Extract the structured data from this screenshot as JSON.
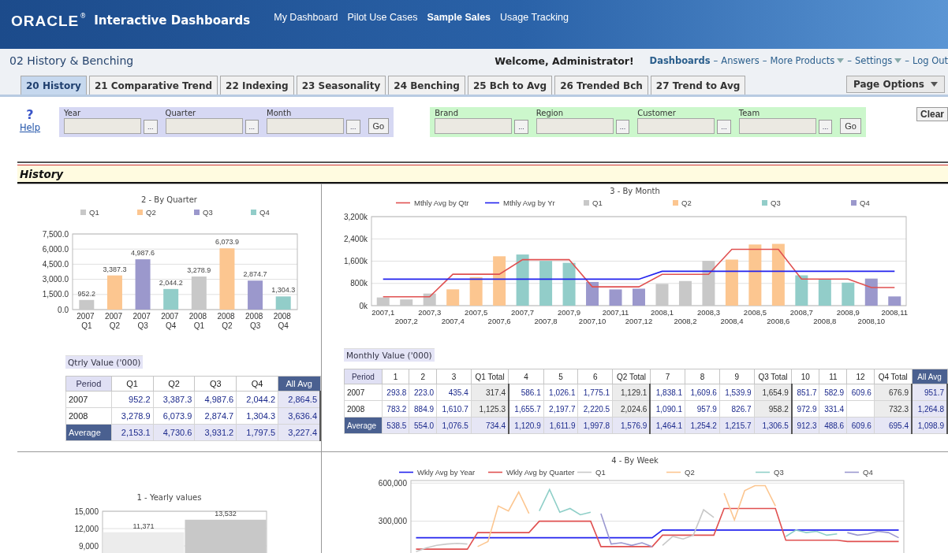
{
  "header": {
    "logo": "ORACLE",
    "logo_mark": "®",
    "app_title": "Interactive Dashboards",
    "nav": [
      {
        "label": "My Dashboard",
        "selected": false
      },
      {
        "label": "Pilot Use Cases",
        "selected": false
      },
      {
        "label": "Sample Sales",
        "selected": true
      },
      {
        "label": "Usage Tracking",
        "selected": false
      }
    ]
  },
  "title_bar": {
    "page_title": "02 History & Benching",
    "welcome": "Welcome, Administrator!",
    "links": [
      {
        "label": "Dashboards",
        "selected": true,
        "menu": false
      },
      {
        "separator": "–",
        "label": "Answers",
        "selected": false,
        "menu": false
      },
      {
        "separator": "–",
        "label": "More Products",
        "selected": false,
        "menu": true
      },
      {
        "separator": "–",
        "label": "Settings",
        "selected": false,
        "menu": true
      },
      {
        "separator": "–",
        "label": "Log Out",
        "selected": false,
        "menu": false
      }
    ]
  },
  "tabs": [
    {
      "label": "20 History",
      "selected": true
    },
    {
      "label": "21 Comparative Trend",
      "selected": false
    },
    {
      "label": "22 Indexing",
      "selected": false
    },
    {
      "label": "23 Seasonality",
      "selected": false
    },
    {
      "label": "24 Benching",
      "selected": false
    },
    {
      "label": "25 Bch to Avg",
      "selected": false
    },
    {
      "label": "26 Trended Bch",
      "selected": false
    },
    {
      "label": "27 Trend to Avg",
      "selected": false
    }
  ],
  "page_options": {
    "label": "Page Options",
    "menu": true
  },
  "help": {
    "mark": "?",
    "label": "Help"
  },
  "prompt_groups": [
    {
      "color": "#d6d8f3",
      "go": "Go",
      "fields": [
        {
          "label": "Year",
          "browse": "..."
        },
        {
          "label": "Quarter",
          "browse": "..."
        },
        {
          "label": "Month",
          "browse": "..."
        }
      ]
    },
    {
      "color": "#ccf7cc",
      "go": "Go",
      "fields": [
        {
          "label": "Brand",
          "browse": "..."
        },
        {
          "label": "Region",
          "browse": "..."
        },
        {
          "label": "Customer",
          "browse": "..."
        },
        {
          "label": "Team",
          "browse": "..."
        }
      ]
    }
  ],
  "clear": "Clear",
  "section_title": "History",
  "quarter_panel": {
    "title": "2 - By Quarter",
    "chart_data": {
      "type": "bar",
      "grid": true,
      "legend": true,
      "categories": [
        "2007 Q1",
        "2007 Q2",
        "2007 Q3",
        "2007 Q4",
        "2008 Q1",
        "2008 Q2",
        "2008 Q3",
        "2008 Q4"
      ],
      "series": [
        {
          "name": "Q1",
          "color": "#c8c8c8",
          "values": [
            952.2,
            null,
            null,
            null,
            3278.9,
            null,
            null,
            null
          ]
        },
        {
          "name": "Q2",
          "color": "#fcc690",
          "values": [
            null,
            3387.3,
            null,
            null,
            null,
            6073.9,
            null,
            null
          ]
        },
        {
          "name": "Q3",
          "color": "#9b98cc",
          "values": [
            null,
            null,
            4987.6,
            null,
            null,
            null,
            2874.7,
            null
          ]
        },
        {
          "name": "Q4",
          "color": "#92cdc9",
          "values": [
            null,
            null,
            null,
            2044.2,
            null,
            null,
            null,
            1304.3
          ]
        }
      ],
      "ylim": [
        0,
        7500
      ],
      "yticks": [
        {
          "value": 0,
          "label": "0.0"
        },
        {
          "value": 1500,
          "label": "1,500.0"
        },
        {
          "value": 3000,
          "label": "3,000.0"
        },
        {
          "value": 4500,
          "label": "4,500.0"
        },
        {
          "value": 6000,
          "label": "6,000.0"
        },
        {
          "value": 7500,
          "label": "7,500.0"
        }
      ],
      "value_labels": [
        "952.2",
        "3,387.3",
        "4,987.6",
        "2,044.2",
        "3,278.9",
        "6,073.9",
        "2,874.7",
        "1,304.3"
      ]
    },
    "table": {
      "title": "Qtrly Value ('000)",
      "columns": [
        {
          "label": "Period",
          "kind": "period"
        },
        {
          "label": "Q1",
          "kind": "value"
        },
        {
          "label": "Q2",
          "kind": "value"
        },
        {
          "label": "Q3",
          "kind": "value"
        },
        {
          "label": "Q4",
          "kind": "value"
        },
        {
          "label": "All Avg",
          "kind": "average"
        }
      ],
      "rows": [
        {
          "kind": "year",
          "cells": [
            "2007",
            "952.2",
            "3,387.3",
            "4,987.6",
            "2,044.2",
            "2,864.5"
          ]
        },
        {
          "kind": "year",
          "cells": [
            "2008",
            "3,278.9",
            "6,073.9",
            "2,874.7",
            "1,304.3",
            "3,636.4"
          ]
        },
        {
          "kind": "average",
          "cells": [
            "Average",
            "2,153.1",
            "4,730.6",
            "3,931.2",
            "1,797.5",
            "3,227.4"
          ]
        }
      ]
    }
  },
  "month_panel": {
    "title": "3 - By Month",
    "chart_data": {
      "type": "bar",
      "grid": true,
      "legend": true,
      "categories": [
        "2007,1",
        "2007,2",
        "2007,3",
        "2007,4",
        "2007,5",
        "2007,6",
        "2007,7",
        "2007,8",
        "2007,9",
        "2007,10",
        "2007,11",
        "2007,12",
        "2008,1",
        "2008,2",
        "2008,3",
        "2008,4",
        "2008,5",
        "2008,6",
        "2008,7",
        "2008,8",
        "2008,9",
        "2008,10",
        "2008,11"
      ],
      "series": [
        {
          "name": "Mthly Avg by Qtr",
          "type": "line",
          "color": "#e05050",
          "values": [
            317,
            317,
            317,
            1129,
            1129,
            1129,
            1655,
            1655,
            1655,
            677,
            677,
            677,
            1125,
            1125,
            1125,
            2025,
            2025,
            2025,
            958,
            958,
            958,
            651,
            651
          ]
        },
        {
          "name": "Mthly Avg by Yr",
          "type": "line",
          "color": "#2222ee",
          "values": [
            952,
            952,
            952,
            952,
            952,
            952,
            952,
            952,
            952,
            952,
            952,
            952,
            1235,
            1235,
            1235,
            1235,
            1235,
            1235,
            1235,
            1235,
            1235,
            1235,
            1235
          ]
        },
        {
          "name": "Q1",
          "color": "#c8c8c8",
          "values": [
            294,
            223,
            435,
            null,
            null,
            null,
            null,
            null,
            null,
            null,
            null,
            null,
            783,
            885,
            1611,
            null,
            null,
            null,
            null,
            null,
            null,
            null,
            null
          ]
        },
        {
          "name": "Q2",
          "color": "#fcc690",
          "values": [
            null,
            null,
            null,
            586,
            1026,
            1775,
            null,
            null,
            null,
            null,
            null,
            null,
            null,
            null,
            null,
            1656,
            2198,
            2221,
            null,
            null,
            null,
            null,
            null
          ]
        },
        {
          "name": "Q3",
          "color": "#92cdc9",
          "values": [
            null,
            null,
            null,
            null,
            null,
            null,
            1838,
            1610,
            1540,
            null,
            null,
            null,
            null,
            null,
            null,
            null,
            null,
            null,
            1090,
            958,
            827,
            null,
            null
          ]
        },
        {
          "name": "Q4",
          "color": "#9b98cc",
          "values": [
            null,
            null,
            null,
            null,
            null,
            null,
            null,
            null,
            null,
            852,
            583,
            610,
            null,
            null,
            null,
            null,
            null,
            null,
            null,
            null,
            null,
            973,
            331
          ]
        }
      ],
      "ylim": [
        0,
        3200
      ],
      "yticks": [
        {
          "value": 0,
          "label": "0k"
        },
        {
          "value": 800,
          "label": "800k"
        },
        {
          "value": 1600,
          "label": "1,600k"
        },
        {
          "value": 2400,
          "label": "2,400k"
        },
        {
          "value": 3200,
          "label": "3,200k"
        }
      ]
    },
    "table": {
      "title": "Monthly Value ('000)",
      "columns": [
        {
          "label": "Period",
          "kind": "period"
        },
        {
          "label": "1",
          "kind": "value"
        },
        {
          "label": "2",
          "kind": "value"
        },
        {
          "label": "3",
          "kind": "value"
        },
        {
          "label": "Q1 Total",
          "kind": "total"
        },
        {
          "label": "4",
          "kind": "value"
        },
        {
          "label": "5",
          "kind": "value"
        },
        {
          "label": "6",
          "kind": "value"
        },
        {
          "label": "Q2 Total",
          "kind": "total"
        },
        {
          "label": "7",
          "kind": "value"
        },
        {
          "label": "8",
          "kind": "value"
        },
        {
          "label": "9",
          "kind": "value"
        },
        {
          "label": "Q3 Total",
          "kind": "total"
        },
        {
          "label": "10",
          "kind": "value"
        },
        {
          "label": "11",
          "kind": "value"
        },
        {
          "label": "12",
          "kind": "value"
        },
        {
          "label": "Q4 Total",
          "kind": "total"
        },
        {
          "label": "All Avg",
          "kind": "average"
        }
      ],
      "rows": [
        {
          "kind": "year",
          "cells": [
            "2007",
            "293.8",
            "223.0",
            "435.4",
            "317.4",
            "586.1",
            "1,026.1",
            "1,775.1",
            "1,129.1",
            "1,838.1",
            "1,609.6",
            "1,539.9",
            "1,654.9",
            "851.7",
            "582.9",
            "609.6",
            "676.9",
            "951.7"
          ]
        },
        {
          "kind": "year",
          "cells": [
            "2008",
            "783.2",
            "884.9",
            "1,610.7",
            "1,125.3",
            "1,655.7",
            "2,197.7",
            "2,220.5",
            "2,024.6",
            "1,090.1",
            "957.9",
            "826.7",
            "958.2",
            "972.9",
            "331.4",
            null,
            "732.3",
            "1,264.8"
          ]
        },
        {
          "kind": "average",
          "cells": [
            "Average",
            "538.5",
            "554.0",
            "1,076.5",
            "734.4",
            "1,120.9",
            "1,611.9",
            "1,997.8",
            "1,576.9",
            "1,464.1",
            "1,254.2",
            "1,215.7",
            "1,306.5",
            "912.3",
            "488.6",
            "609.6",
            "695.4",
            "1,098.9"
          ]
        }
      ]
    }
  },
  "year_panel": {
    "title": "1 - Yearly values",
    "chart_data": {
      "type": "bar",
      "grid": true,
      "series": [
        {
          "color": "#ececec",
          "values": [
            11371,
            null
          ]
        },
        {
          "color": "#c8c8c8",
          "values": [
            null,
            13532
          ]
        }
      ],
      "ylim": [
        0,
        15000
      ],
      "yticks": [
        {
          "value": 9000,
          "label": "9,000"
        },
        {
          "value": 12000,
          "label": "12,000"
        },
        {
          "value": 15000,
          "label": "15,000"
        }
      ],
      "value_labels": [
        "11,371",
        "13,532"
      ]
    }
  },
  "week_panel": {
    "title": "4 - By Week",
    "chart_data": {
      "type": "line",
      "grid": true,
      "legend": true,
      "series": [
        {
          "name": "Wkly Avg by Year",
          "color": "#2222ee",
          "values": [
            170000,
            170000,
            170000,
            170000,
            170000,
            170000,
            170000,
            170000,
            170000,
            170000,
            170000,
            170000,
            170000,
            170000,
            170000,
            170000,
            170000,
            170000,
            170000,
            170000,
            170000,
            170000,
            170000,
            170000,
            230000,
            230000,
            230000,
            230000,
            230000,
            230000,
            230000,
            230000,
            230000,
            230000,
            230000,
            230000,
            230000,
            230000,
            230000,
            230000,
            230000,
            230000,
            230000,
            230000,
            230000,
            230000,
            230000,
            230000
          ]
        },
        {
          "name": "Wkly Avg by Quarter",
          "color": "#e05050",
          "values": [
            80000,
            80000,
            80000,
            80000,
            80000,
            80000,
            210000,
            210000,
            210000,
            210000,
            210000,
            210000,
            300000,
            300000,
            300000,
            300000,
            300000,
            300000,
            100000,
            100000,
            100000,
            100000,
            100000,
            100000,
            190000,
            190000,
            190000,
            190000,
            190000,
            190000,
            400000,
            400000,
            400000,
            400000,
            400000,
            400000,
            150000,
            150000,
            150000,
            150000,
            150000,
            150000,
            140000,
            140000,
            140000,
            140000,
            140000,
            140000
          ]
        },
        {
          "name": "Q1",
          "color": "#c8c8c8",
          "values": [
            60000,
            90000,
            110000,
            120000,
            125000,
            120000,
            null,
            null,
            null,
            null,
            null,
            null,
            null,
            null,
            null,
            null,
            null,
            null,
            null,
            null,
            null,
            null,
            null,
            null,
            110000,
            180000,
            160000,
            190000,
            390000,
            330000,
            null,
            null,
            null,
            null,
            null,
            null,
            null,
            null,
            null,
            null,
            null,
            null,
            null,
            null,
            null,
            null,
            null,
            null
          ]
        },
        {
          "name": "Q2",
          "color": "#fcc690",
          "values": [
            null,
            null,
            null,
            null,
            null,
            null,
            100000,
            140000,
            420000,
            380000,
            530000,
            360000,
            null,
            null,
            null,
            null,
            null,
            null,
            null,
            null,
            null,
            null,
            null,
            null,
            null,
            null,
            null,
            null,
            null,
            null,
            520000,
            310000,
            540000,
            580000,
            580000,
            420000,
            null,
            null,
            null,
            null,
            null,
            null,
            null,
            null,
            null,
            null,
            null,
            null
          ]
        },
        {
          "name": "Q3",
          "color": "#8fcfc8",
          "values": [
            null,
            null,
            null,
            null,
            null,
            null,
            null,
            null,
            null,
            null,
            null,
            null,
            380000,
            550000,
            370000,
            400000,
            350000,
            370000,
            null,
            null,
            null,
            null,
            null,
            null,
            null,
            null,
            null,
            null,
            null,
            null,
            null,
            null,
            null,
            null,
            null,
            null,
            180000,
            230000,
            210000,
            220000,
            190000,
            200000,
            null,
            null,
            null,
            null,
            null,
            null
          ]
        },
        {
          "name": "Q4",
          "color": "#9b98d0",
          "values": [
            null,
            null,
            null,
            null,
            null,
            null,
            null,
            null,
            null,
            null,
            null,
            null,
            null,
            null,
            null,
            null,
            null,
            null,
            360000,
            120000,
            130000,
            110000,
            130000,
            100000,
            null,
            null,
            null,
            null,
            null,
            null,
            null,
            null,
            null,
            null,
            null,
            null,
            null,
            null,
            null,
            null,
            null,
            null,
            210000,
            190000,
            200000,
            220000,
            210000,
            170000
          ]
        }
      ],
      "ylim": [
        0,
        620000
      ],
      "yticks": [
        {
          "value": 300000,
          "label": "300,000"
        },
        {
          "value": 600000,
          "label": "600,000"
        }
      ]
    }
  }
}
